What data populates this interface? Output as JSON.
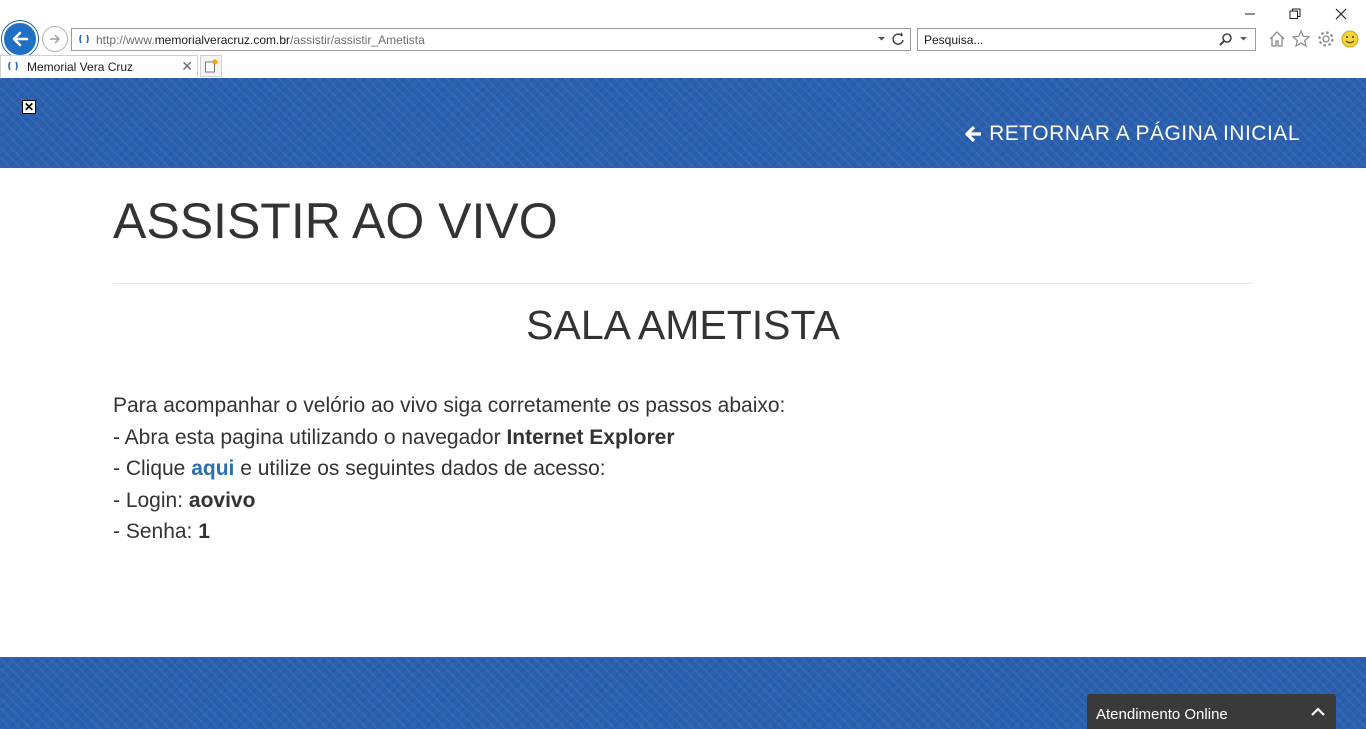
{
  "browser": {
    "url_prefix": "http://www.",
    "url_domain": "memorialveracruz.com.br",
    "url_path": "/assistir/assistir_Ametista",
    "search_placeholder": "Pesquisa...",
    "tab_title": "Memorial Vera Cruz"
  },
  "header": {
    "close_glyph": "✕",
    "return_label": "RETORNAR A PÁGINA INICIAL"
  },
  "main": {
    "title": "ASSISTIR AO VIVO",
    "room": "SALA AMETISTA",
    "intro": "Para acompanhar o velório ao vivo siga corretamente os passos abaixo:",
    "step1_prefix": "- Abra esta pagina utilizando o navegador ",
    "step1_bold": "Internet Explorer",
    "step2_prefix": "- Clique ",
    "step2_link": "aqui",
    "step2_suffix": " e utilize os seguintes dados de acesso:",
    "login_prefix": "- Login: ",
    "login_value": "aovivo",
    "senha_prefix": "- Senha: ",
    "senha_value": "1"
  },
  "chat": {
    "label": "Atendimento Online"
  },
  "colors": {
    "brand_blue": "#2a60af",
    "link_blue": "#2a6eb5",
    "chat_bg": "#3a3a3a"
  }
}
